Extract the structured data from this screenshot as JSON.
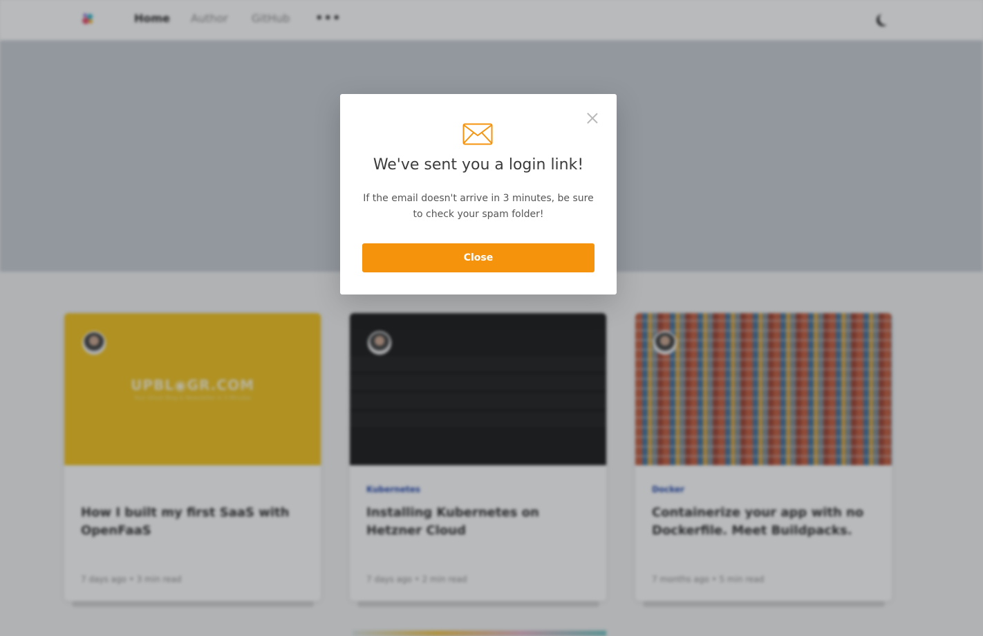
{
  "nav": {
    "links": [
      "Home",
      "Author",
      "GitHub"
    ],
    "more": "•••"
  },
  "modal": {
    "title": "We've sent you a login link!",
    "text": "If the email doesn't arrive in 3 minutes, be sure to check your spam folder!",
    "button_label": "Close",
    "accent_color": "#f5930d"
  },
  "posts": [
    {
      "tag": "",
      "title": "How I built my first SaaS with OpenFaaS",
      "meta": "7 days ago  •  3 min read",
      "image_brand": "UPBL◉GR.COM",
      "image_tagline": "Your Ghost Blog & Newsletter in 5 Minutes"
    },
    {
      "tag": "Kubernetes",
      "title": "Installing Kubernetes on Hetzner Cloud",
      "meta": "7 days ago  •  2 min read"
    },
    {
      "tag": "Docker",
      "title": "Containerize your app with no Dockerfile. Meet Buildpacks.",
      "meta": "7 months ago  •  5 min read"
    }
  ]
}
